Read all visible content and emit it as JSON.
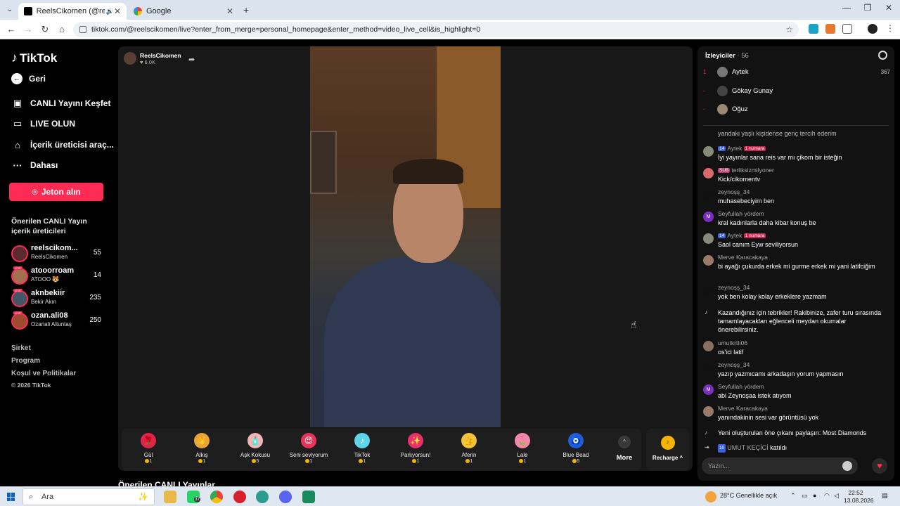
{
  "browser": {
    "tabs": [
      {
        "title": "ReelsCikomen (@reelsciko",
        "active": true
      },
      {
        "title": "Google",
        "active": false
      }
    ],
    "new_tab": "+",
    "url": "tiktok.com/@reelscikomen/live?enter_from_merge=personal_homepage&enter_method=video_live_cell&is_highlight=0"
  },
  "sidebar": {
    "logo": "TikTok",
    "nav": [
      {
        "label": "Geri",
        "icon": "back-arrow-icon"
      },
      {
        "label": "CANLI Yayını Keşfet",
        "icon": "live-explore-icon"
      },
      {
        "label": "LIVE OLUN",
        "icon": "camera-icon"
      },
      {
        "label": "İçerik üreticisi araç...",
        "icon": "creator-tools-icon"
      },
      {
        "label": "Dahası",
        "icon": "more-dots-icon"
      }
    ],
    "coin_button": "Jeton alın",
    "suggested_title": "Önerilen CANLI Yayın içerik üreticileri",
    "live_badge": "LIVE",
    "creators": [
      {
        "handle": "reelscikom...",
        "name": "ReelsCikomen",
        "count": "55"
      },
      {
        "handle": "atooorroam",
        "name": "ATOOO 🐯",
        "count": "14"
      },
      {
        "handle": "aknbekiir",
        "name": "Bekir Akın",
        "count": "235"
      },
      {
        "handle": "ozan.ali08",
        "name": "Ozanali Altuntaş",
        "count": "250"
      }
    ],
    "footer": [
      "Şirket",
      "Program",
      "Koşul ve Politikalar",
      "© 2026 TikTok"
    ]
  },
  "stream": {
    "host": "ReelsCikomen",
    "likes": "♥ 6.0K",
    "gifts": [
      {
        "name": "Gül",
        "price": "1",
        "color": "#e0244a",
        "glyph": "🌹"
      },
      {
        "name": "Alkış",
        "price": "1",
        "color": "#e8a53a",
        "glyph": "👏"
      },
      {
        "name": "Aşk Kokusu",
        "price": "5",
        "color": "#f0b5b5",
        "glyph": "🧴"
      },
      {
        "name": "Seni seviyorum",
        "price": "1",
        "color": "#e8345a",
        "glyph": "😍"
      },
      {
        "name": "TikTok",
        "price": "1",
        "color": "#5fd3e8",
        "glyph": "♪"
      },
      {
        "name": "Parlıyorsun!",
        "price": "1",
        "color": "#e8306a",
        "glyph": "✨"
      },
      {
        "name": "Aferin",
        "price": "1",
        "color": "#f2c23a",
        "glyph": "👍"
      },
      {
        "name": "Lale",
        "price": "1",
        "color": "#f08aa8",
        "glyph": "🌷"
      },
      {
        "name": "Blue Bead",
        "price": "5",
        "color": "#1e5fd8",
        "glyph": "🧿"
      }
    ],
    "more_label": "More",
    "recharge_label": "Recharge ^",
    "below_label": "Önerilen CANLI Yayınlar"
  },
  "chat": {
    "viewers_label": "İzleyiciler",
    "viewers_count": "· 56",
    "top_viewers": [
      {
        "rank": "1",
        "name": "Aytek",
        "score": "367"
      },
      {
        "rank": "-",
        "name": "Gökay Gunay",
        "score": ""
      },
      {
        "rank": "-",
        "name": "Oğuz",
        "score": ""
      }
    ],
    "messages": [
      {
        "name": "",
        "badges": [],
        "text": "yandaki yaşlı kişidense genç tercih ederim",
        "avatar": "#555"
      },
      {
        "name": "Aytek",
        "badges": [
          "14",
          "1 numara"
        ],
        "text": "İyi yayınlar sana reis var mı çikom bir isteğin",
        "avatar": "#8a8a7a"
      },
      {
        "name": "terliksizmilyoner",
        "badges": [
          "SUB"
        ],
        "text": "Kick/cikomentv",
        "avatar": "#d86a6a"
      },
      {
        "name": "zeynoşş_34",
        "badges": [],
        "text": "muhasebeciyim ben",
        "avatar": "#111"
      },
      {
        "name": "Seyfullah yördem",
        "badges": [],
        "text": "kral kadınlarla daha kibar konuş be",
        "avatar": "#7b2fbe"
      },
      {
        "name": "Aytek",
        "badges": [
          "14",
          "1 numara"
        ],
        "text": "Saol canım Eyw seviliyorsun",
        "avatar": "#8a8a7a"
      },
      {
        "name": "Merve Karacakaya",
        "badges": [],
        "text": "bi ayağı çukurda erkek mi gurme erkek mi yani latifciğim",
        "avatar": "#9a7a68"
      },
      {
        "name": "zeynoşş_34",
        "badges": [],
        "text": "yok ben kolay kolay erkeklere yazmam",
        "avatar": "#111"
      }
    ],
    "system_message": "Kazandığınız için tebrikler! Rakibinize, zafer turu sırasında tamamlayacakları eğlenceli meydan okumalar önerebilirsiniz.",
    "messages2": [
      {
        "name": "umutkrtlı06",
        "badges": [],
        "text": "os'ici latif",
        "avatar": "#8a7060"
      },
      {
        "name": "zeynoşş_34",
        "badges": [],
        "text": "yazıp yazmıcamı arkadaşın yorum yapmasın",
        "avatar": "#111"
      },
      {
        "name": "Seyfullah yördem",
        "badges": [],
        "text": "abi Zeynoşaa istek atıyom",
        "avatar": "#7b2fbe"
      },
      {
        "name": "Merve Karacakaya",
        "badges": [],
        "text": "yanındakinin sesi var görüntüsü yok",
        "avatar": "#9a7a68"
      }
    ],
    "system_message2": "Yeni oluşturulan öne çıkanı paylaşın: Most Diamonds",
    "join_badge": "10",
    "join_name": "UMUT KEÇİCİ",
    "join_text": "katıldı",
    "input_placeholder": "Yazın..."
  },
  "taskbar": {
    "search_placeholder": "Ara",
    "badge_count": "37",
    "weather": "28°C  Genellikle açık",
    "time": "22:52",
    "date": "13.08.2026"
  }
}
